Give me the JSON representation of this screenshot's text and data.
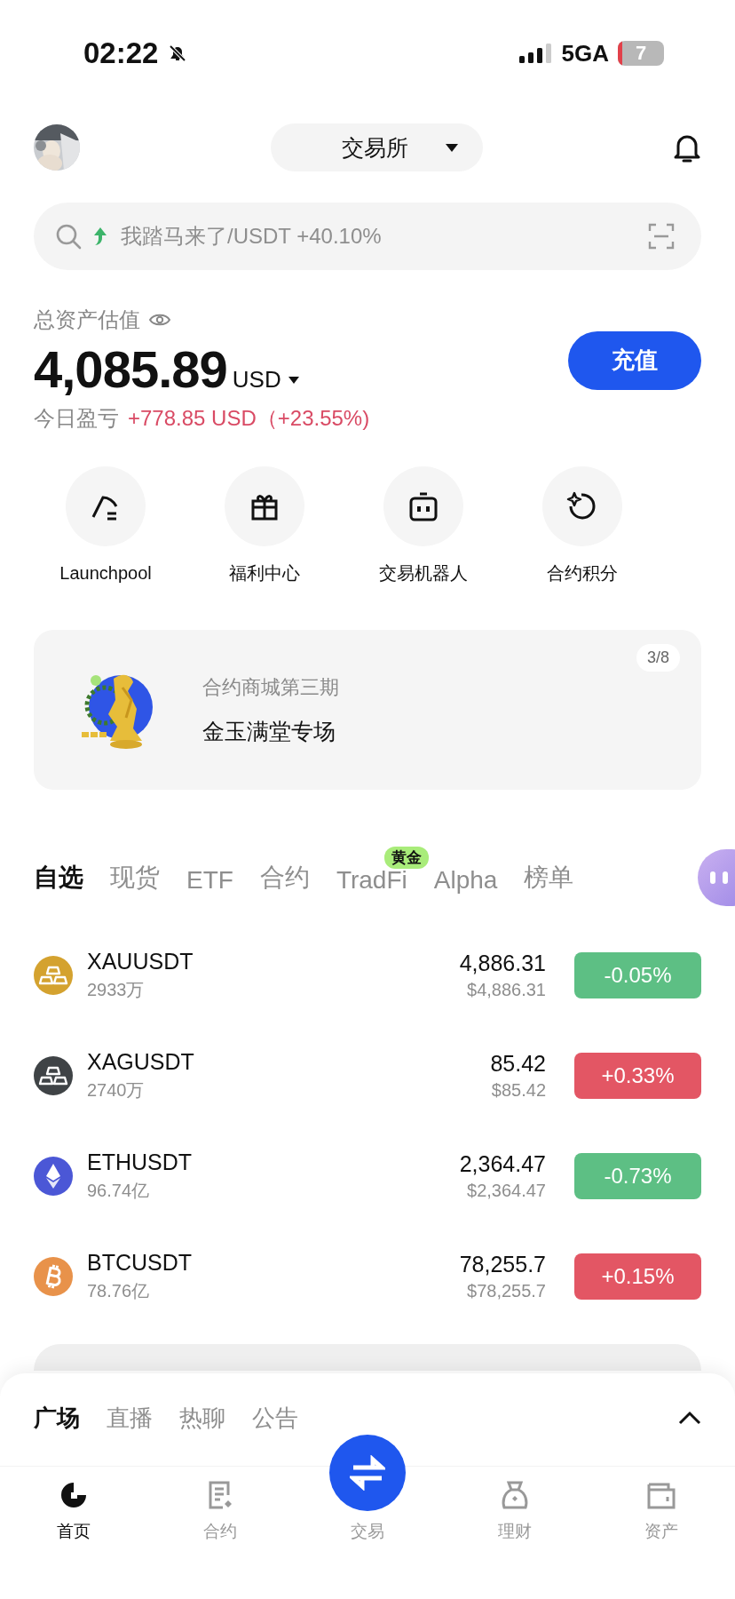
{
  "status_bar": {
    "time": "02:22",
    "network": "5GA",
    "battery": "7"
  },
  "header": {
    "exchange": "交易所"
  },
  "search": {
    "placeholder": "我踏马来了/USDT +40.10%"
  },
  "assets": {
    "label": "总资产估值",
    "total": "4,085.89",
    "currency": "USD",
    "deposit": "充值",
    "pnl_label": "今日盈亏",
    "pnl_value": "+778.85 USD（+23.55%)"
  },
  "shortcuts": [
    {
      "kind": "pick",
      "label": "Launchpool"
    },
    {
      "kind": "gift",
      "label": "福利中心"
    },
    {
      "kind": "robot",
      "label": "交易机器人"
    },
    {
      "kind": "points",
      "label": "合约积分"
    }
  ],
  "banner": {
    "kind": "picture",
    "subtitle": "合约商城第三期",
    "title": "金玉满堂专场",
    "page": "3/8"
  },
  "tabs": [
    {
      "label": "自选",
      "selected": true
    },
    {
      "label": "现货",
      "selected": false
    },
    {
      "label": "ETF",
      "selected": false
    },
    {
      "label": "合约",
      "selected": false
    },
    {
      "label": "TradFi",
      "selected": false,
      "badge": "黄金"
    },
    {
      "label": "Alpha",
      "selected": false
    },
    {
      "label": "榜单",
      "selected": false
    }
  ],
  "markets": [
    {
      "kind": "bars",
      "color": "#d4a22f",
      "symbol": "XAUUSDT",
      "volume": "2933万",
      "price": "4,886.31",
      "usd": "$4,886.31",
      "change": "-0.05%",
      "rising": false
    },
    {
      "kind": "bars",
      "color": "#3f4346",
      "symbol": "XAGUSDT",
      "volume": "2740万",
      "price": "85.42",
      "usd": "$85.42",
      "change": "+0.33%",
      "rising": true
    },
    {
      "kind": "eth",
      "color": "#4b57d6",
      "symbol": "ETHUSDT",
      "volume": "96.74亿",
      "price": "2,364.47",
      "usd": "$2,364.47",
      "change": "-0.73%",
      "rising": false
    },
    {
      "kind": "btc",
      "color": "#e8924a",
      "symbol": "BTCUSDT",
      "volume": "78.76亿",
      "price": "78,255.7",
      "usd": "$78,255.7",
      "change": "+0.15%",
      "rising": true
    }
  ],
  "feed_tabs": [
    {
      "label": "广场",
      "selected": true
    },
    {
      "label": "直播",
      "selected": false
    },
    {
      "label": "热聊",
      "selected": false
    },
    {
      "label": "公告",
      "selected": false
    }
  ],
  "nav": [
    {
      "kind": "home",
      "label": "首页",
      "selected": true
    },
    {
      "kind": "contract",
      "label": "合约",
      "selected": false
    },
    {
      "kind": "trade",
      "label": "交易",
      "selected": false
    },
    {
      "kind": "earn",
      "label": "理财",
      "selected": false
    },
    {
      "kind": "wallet",
      "label": "资产",
      "selected": false
    }
  ]
}
